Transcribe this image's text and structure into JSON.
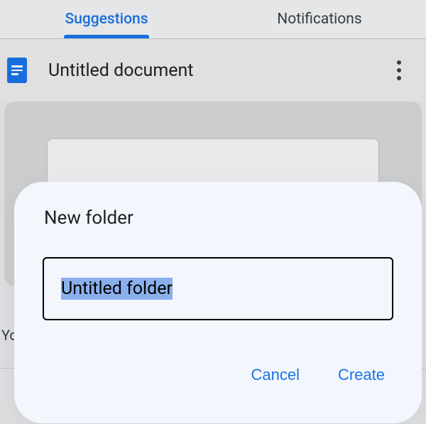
{
  "tabs": {
    "suggestions": "Suggestions",
    "notifications": "Notifications"
  },
  "document": {
    "title": "Untitled document"
  },
  "partial_text": "Yo",
  "dialog": {
    "title": "New folder",
    "input_value": "Untitled folder",
    "cancel": "Cancel",
    "create": "Create"
  }
}
